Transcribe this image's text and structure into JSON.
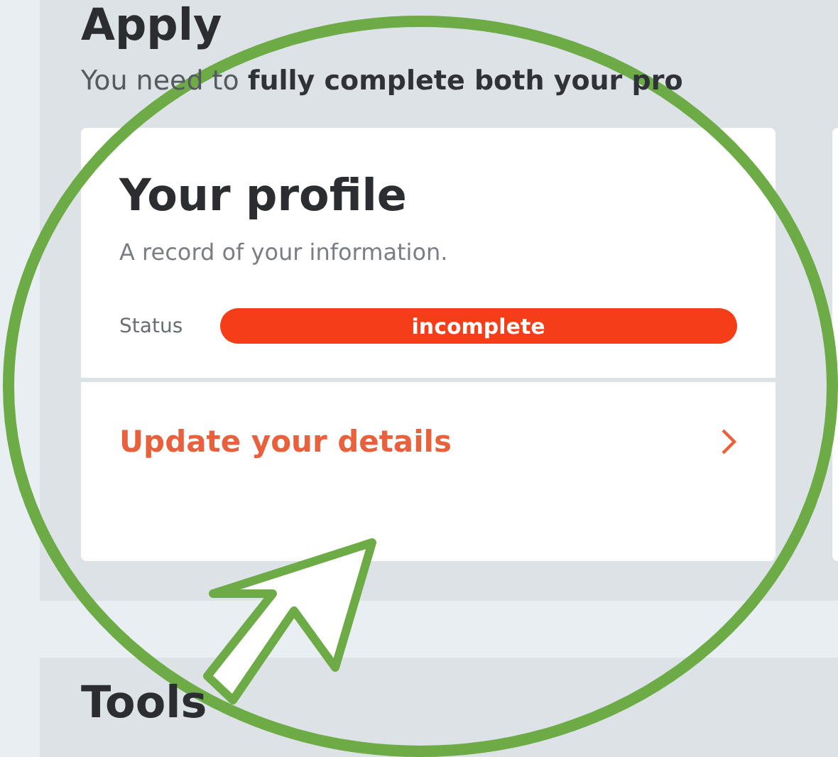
{
  "section": {
    "title": "Apply",
    "intro": "You need to **fully complete both your pro**"
  },
  "cards": [
    {
      "title": "Your profile",
      "description": "A record of your information.",
      "status_label": "Status",
      "status": {
        "kind": "incomplete",
        "text": "incomplete"
      },
      "link": "Update your details"
    }
  ],
  "next_section": {
    "title": "Tools"
  }
}
